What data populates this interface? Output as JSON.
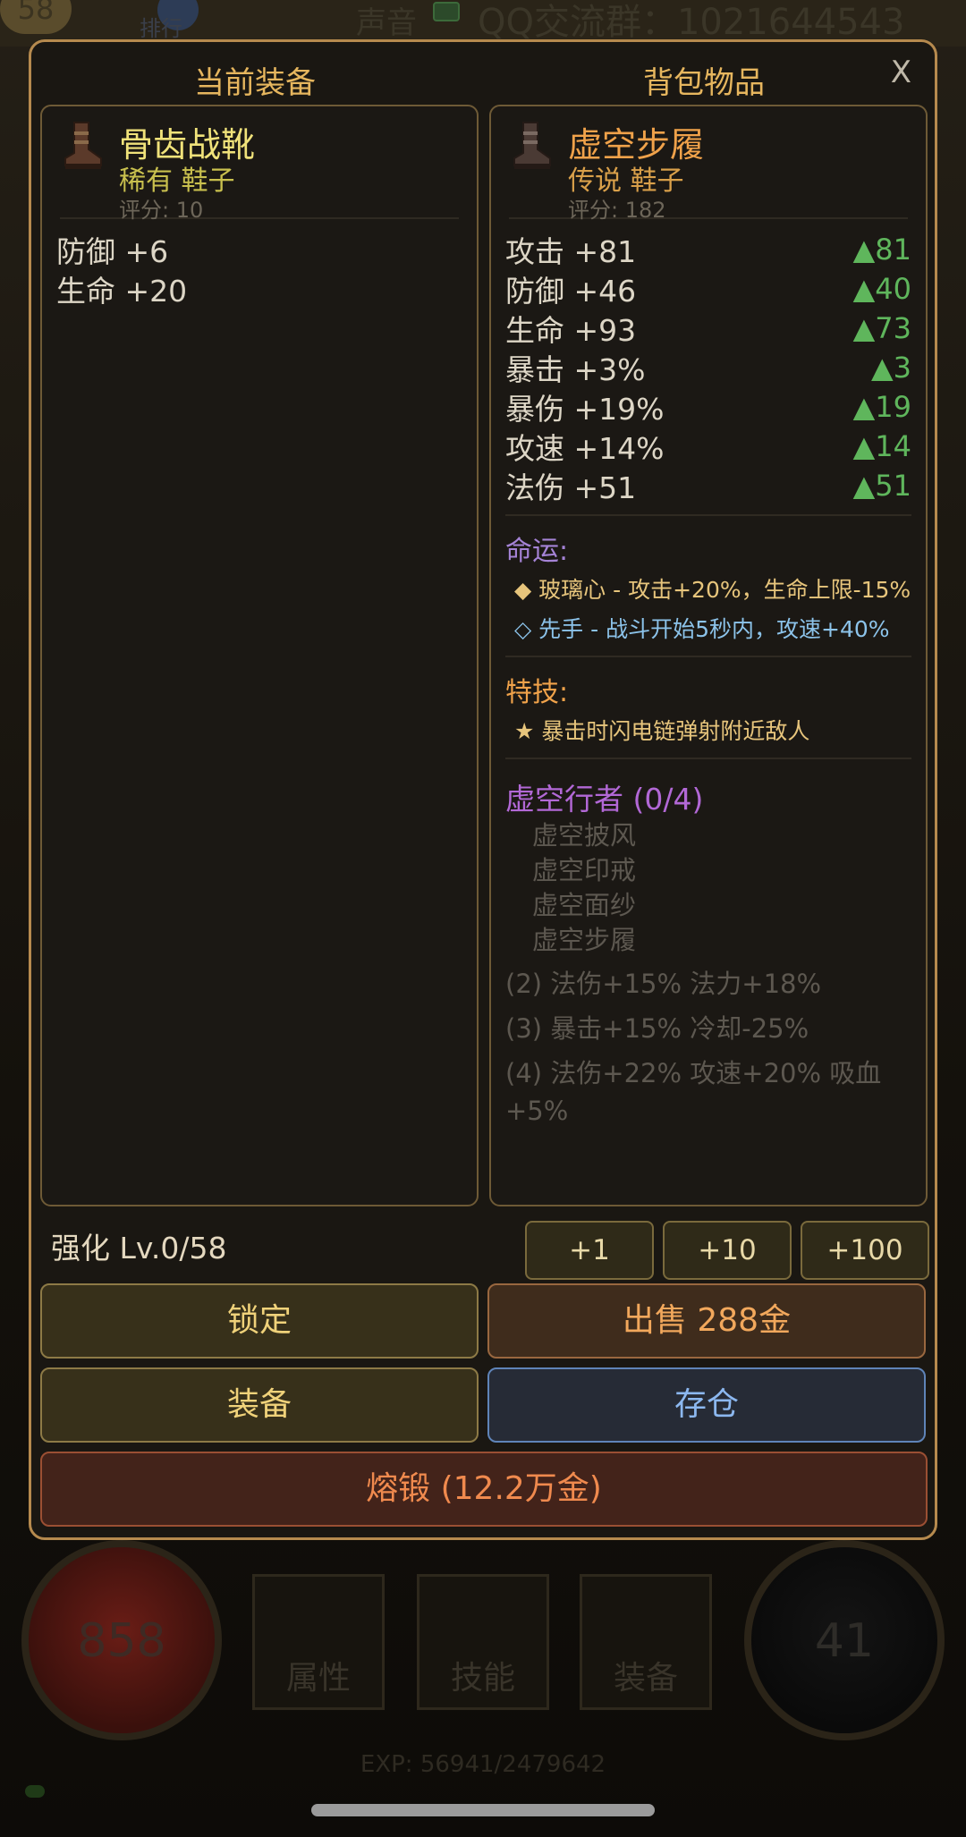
{
  "background": {
    "level": "58",
    "rank_label": "排行",
    "sound_label": "声音",
    "qq_group": "QQ交流群：1021644543",
    "hp_value": "858",
    "mp_value": "41",
    "nav": [
      "属性",
      "技能",
      "装备"
    ],
    "exp": "EXP: 56941/2479642"
  },
  "modal": {
    "left_title": "当前装备",
    "right_title": "背包物品",
    "close_label": "X"
  },
  "current_item": {
    "name": "骨齿战靴",
    "quality_slot": "稀有 鞋子",
    "score": "评分: 10",
    "name_color": "#f0e27a",
    "stats": [
      {
        "label": "防御 +6"
      },
      {
        "label": "生命 +20"
      }
    ]
  },
  "bag_item": {
    "name": "虚空步履",
    "quality_slot": "传说 鞋子",
    "score": "评分: 182",
    "name_color": "#f0a24a",
    "stats": [
      {
        "label": "攻击 +81",
        "diff": "▲81"
      },
      {
        "label": "防御 +46",
        "diff": "▲40"
      },
      {
        "label": "生命 +93",
        "diff": "▲73"
      },
      {
        "label": "暴击 +3%",
        "diff": "▲3"
      },
      {
        "label": "暴伤 +19%",
        "diff": "▲19"
      },
      {
        "label": "攻速 +14%",
        "diff": "▲14"
      },
      {
        "label": "法伤 +51",
        "diff": "▲51"
      }
    ],
    "fate_label": "命运:",
    "fates": [
      {
        "text": "◆ 玻璃心 - 攻击+20%，生命上限-15%",
        "color": "#e7c57c"
      },
      {
        "text": "◇ 先手 - 战斗开始5秒内，攻速+40%",
        "color": "#8cc3ea"
      }
    ],
    "skill_label": "特技:",
    "skill": "★ 暴击时闪电链弹射附近敌人",
    "set_title": "虚空行者 (0/4)",
    "set_pieces": [
      "虚空披风",
      "虚空印戒",
      "虚空面纱",
      "虚空步履"
    ],
    "set_bonuses": [
      "(2) 法伤+15% 法力+18%",
      "(3) 暴击+15% 冷却-25%",
      "(4) 法伤+22% 攻速+20% 吸血+5%"
    ]
  },
  "controls": {
    "upgrade_label": "强化 Lv.0/58",
    "plus1": "+1",
    "plus10": "+10",
    "plus100": "+100",
    "lock": "锁定",
    "sell": "出售 288金",
    "equip": "装备",
    "store": "存仓",
    "smelt": "熔锻 (12.2万金)"
  }
}
